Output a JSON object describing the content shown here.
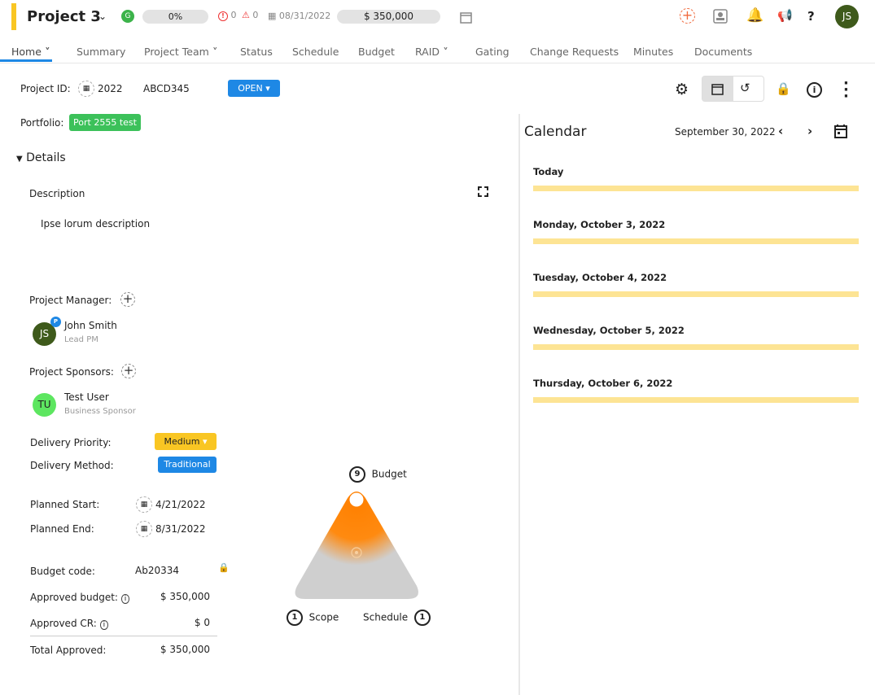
{
  "header": {
    "title": "Project 3",
    "health": "G",
    "progress": "0%",
    "issues": "0",
    "risks": "0",
    "due_date": "08/31/2022",
    "budget": "$ 350,000",
    "avatar": "JS",
    "accent": "#f9c623"
  },
  "tabs": [
    {
      "label": "Home",
      "active": true
    },
    {
      "label": "Summary"
    },
    {
      "label": "Project Team"
    },
    {
      "label": "Status"
    },
    {
      "label": "Schedule"
    },
    {
      "label": "Budget"
    },
    {
      "label": "RAID"
    },
    {
      "label": "Gating"
    },
    {
      "label": "Change Requests"
    },
    {
      "label": "Minutes"
    },
    {
      "label": "Documents"
    }
  ],
  "project": {
    "id_label": "Project ID:",
    "year": "2022",
    "code": "ABCD345",
    "status": "OPEN",
    "portfolio_label": "Portfolio:",
    "portfolio": "Port 2555 test"
  },
  "details": {
    "heading": "Details",
    "description_label": "Description",
    "description": "Ipse lorum description",
    "pm_label": "Project Manager:",
    "pm_name": "John Smith",
    "pm_role": "Lead PM",
    "pm_initials": "JS",
    "pm_badge": "P",
    "sponsors_label": "Project Sponsors:",
    "sponsor_name": "Test User",
    "sponsor_role": "Business Sponsor",
    "sponsor_initials": "TU",
    "priority_label": "Delivery Priority:",
    "priority": "Medium",
    "method_label": "Delivery Method:",
    "method": "Traditional",
    "start_label": "Planned Start:",
    "start": "4/21/2022",
    "end_label": "Planned End:",
    "end": "8/31/2022",
    "budget_code_label": "Budget code:",
    "budget_code": "Ab20334",
    "approved_budget_label": "Approved budget:",
    "approved_budget": "$ 350,000",
    "approved_cr_label": "Approved CR:",
    "approved_cr": "$ 0",
    "total_label": "Total Approved:",
    "total": "$ 350,000"
  },
  "triangle": {
    "budget_label": "Budget",
    "budget": "9",
    "scope_label": "Scope",
    "scope": "1",
    "schedule_label": "Schedule",
    "schedule": "1"
  },
  "calendar": {
    "title": "Calendar",
    "date": "September 30, 2022",
    "days": [
      "Today",
      "Monday, October 3, 2022",
      "Tuesday, October 4, 2022",
      "Wednesday, October 5, 2022",
      "Thursday, October 6, 2022"
    ]
  }
}
